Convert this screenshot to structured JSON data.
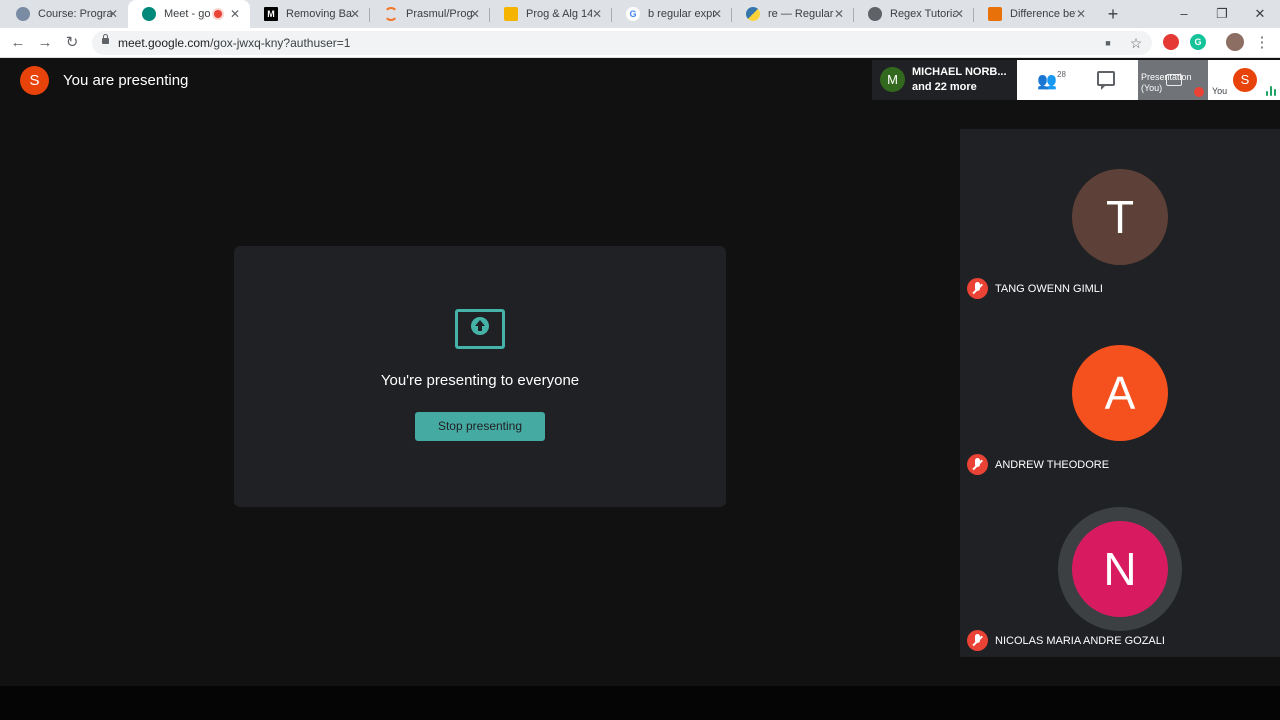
{
  "browser": {
    "tabs": [
      {
        "title": "Course: Progra",
        "favicon": "moodle-icon",
        "favicon_color": "#7a8ca3",
        "active": false
      },
      {
        "title": "Meet - go",
        "favicon": "meet-icon",
        "favicon_color": "#00897b",
        "active": true,
        "recording": true
      },
      {
        "title": "Removing Back",
        "favicon": "medium-icon",
        "favicon_color": "#000000",
        "active": false
      },
      {
        "title": "Prasmul/Progr",
        "favicon": "jupyter-icon",
        "favicon_color": "#f37726",
        "active": false
      },
      {
        "title": "Prog & Alg 14",
        "favicon": "slides-icon",
        "favicon_color": "#f4b400",
        "active": false
      },
      {
        "title": "b regular expre",
        "favicon": "google-icon",
        "favicon_color": "#4285f4",
        "active": false
      },
      {
        "title": "re — Regular e",
        "favicon": "python-icon",
        "favicon_color": "#3776ab",
        "active": false
      },
      {
        "title": "Regex Tutorial",
        "favicon": "globe-icon",
        "favicon_color": "#5f6368",
        "active": false
      },
      {
        "title": "Difference betw",
        "favicon": "pencil-icon",
        "favicon_color": "#e8710a",
        "active": false
      }
    ],
    "new_tab_label": "+",
    "window_controls": {
      "minimize": "–",
      "restore": "❐",
      "close": "✕"
    },
    "nav": {
      "back": "←",
      "forward": "→",
      "reload": "↻"
    },
    "url_host": "meet.google.com",
    "url_path": "/gox-jwxq-kny?authuser=1",
    "toolbar_icons": {
      "camera": "■",
      "star": "☆",
      "menu": "⋮"
    }
  },
  "meet": {
    "self_initial": "S",
    "self_color": "#e8430a",
    "presenting_title": "You are presenting",
    "pinned": {
      "initial": "M",
      "color": "#33691e",
      "name": "MICHAEL NORB...",
      "more": "and 22 more"
    },
    "participant_count": "28",
    "presentation_tile_label": "Presentation (You)",
    "you_label": "You",
    "present_message": "You're presenting to everyone",
    "stop_label": "Stop presenting",
    "accent": "#45aaa2",
    "participants": [
      {
        "initial": "T",
        "name": "TANG OWENN GIMLI",
        "color": "#5d4037",
        "muted": true,
        "speaking": false
      },
      {
        "initial": "A",
        "name": "ANDREW THEODORE",
        "color": "#f4511e",
        "muted": true,
        "speaking": false
      },
      {
        "initial": "N",
        "name": "NICOLAS MARIA ANDRE GOZALI",
        "color": "#d81b60",
        "muted": true,
        "speaking": true
      }
    ]
  }
}
